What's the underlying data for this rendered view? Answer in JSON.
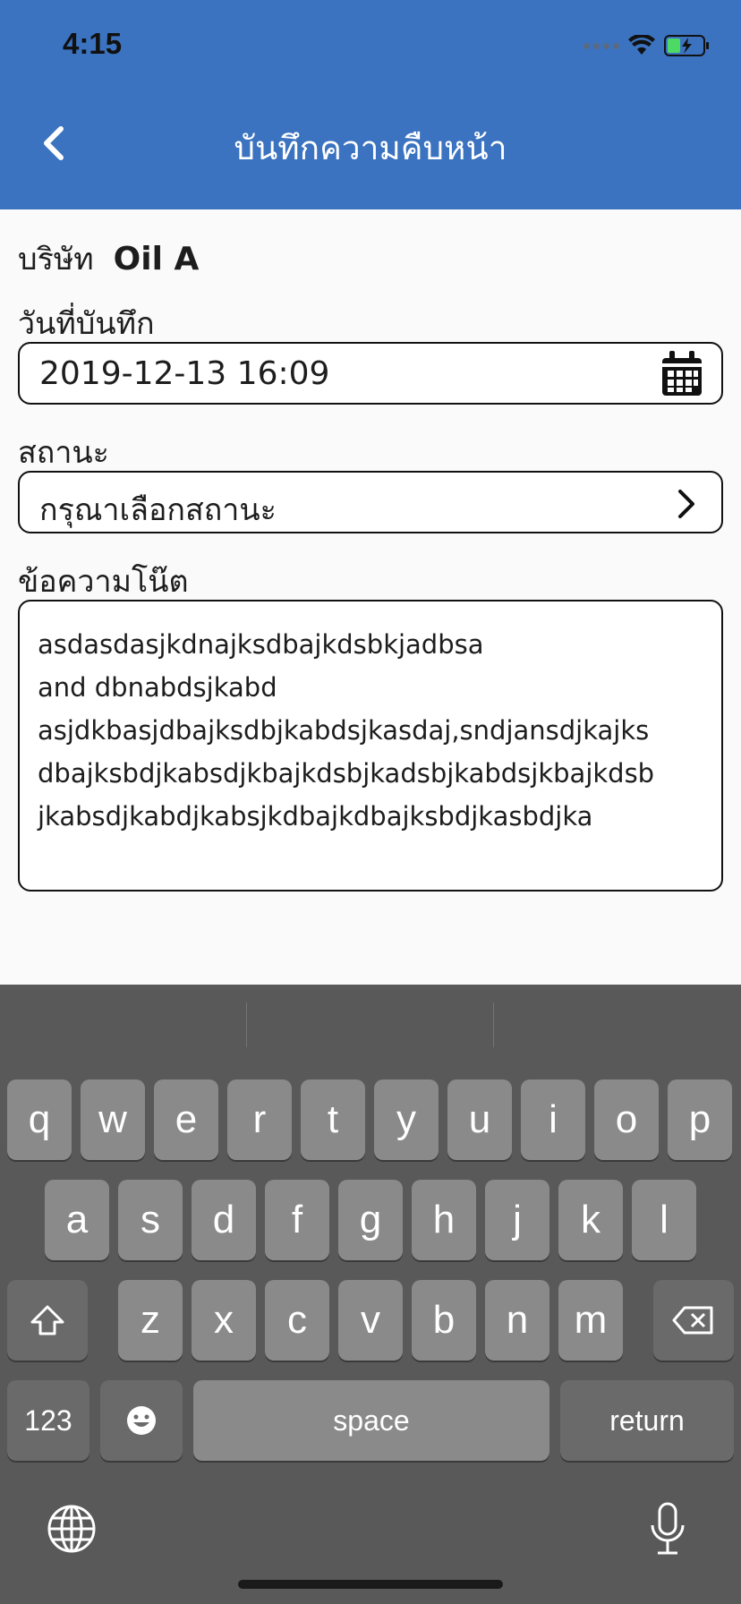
{
  "status_bar": {
    "time": "4:15"
  },
  "header": {
    "title": "บันทึกความคืบหน้า",
    "back_icon": "chevron-left-icon"
  },
  "form": {
    "company_label": "บริษัท",
    "company_value": "Oil A",
    "date_label": "วันที่บันทึก",
    "date_value": "2019-12-13 16:09",
    "status_label": "สถานะ",
    "status_placeholder": "กรุณาเลือกสถานะ",
    "note_label": "ข้อความโน๊ต",
    "note_text": "asdasdasjkdnajksdbajkdsbkjadbsa\nand dbnabdsjkabd\nasjdkbasjdbajksdbjkabdsjkasdaj,sndjansdjkajks\ndbajksbdjkabsdjkbajkdsbjkadsbjkabdsjkbajkdsb\njkabsdjkabdjkabsjkdbajkdbajksbdjkasbdjka"
  },
  "keyboard": {
    "row1": [
      "q",
      "w",
      "e",
      "r",
      "t",
      "y",
      "u",
      "i",
      "o",
      "p"
    ],
    "row2": [
      "a",
      "s",
      "d",
      "f",
      "g",
      "h",
      "j",
      "k",
      "l"
    ],
    "row3": [
      "z",
      "x",
      "c",
      "v",
      "b",
      "n",
      "m"
    ],
    "numbers_label": "123",
    "space_label": "space",
    "return_label": "return"
  },
  "colors": {
    "header": "#3b73c0",
    "keyboard": "#595959",
    "key": "#8a8a8a",
    "battery": "#4cd964"
  }
}
